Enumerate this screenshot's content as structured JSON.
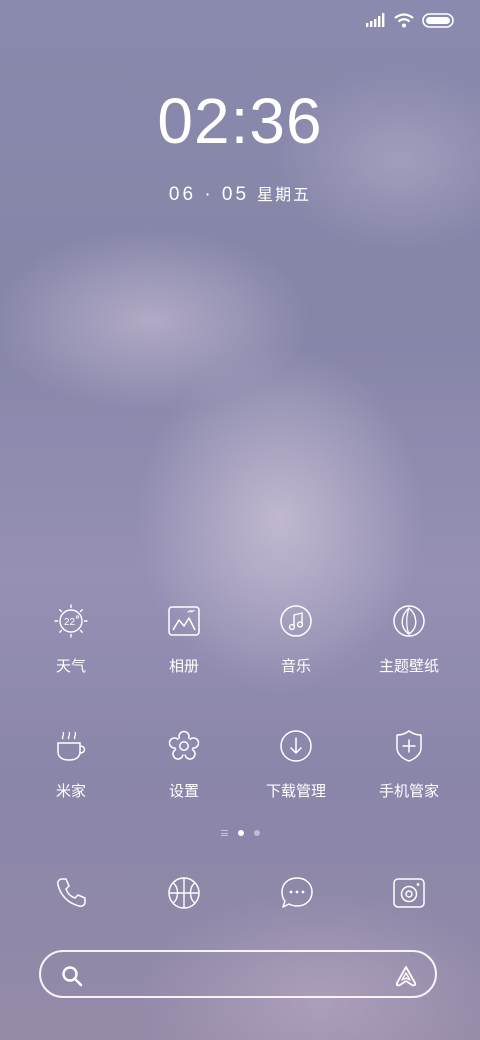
{
  "status_bar": {
    "icons": [
      "signal-icon",
      "wifi-icon",
      "battery-icon"
    ]
  },
  "lockscreen": {
    "time": "02:36",
    "date": "06 · 05",
    "weekday": "星期五"
  },
  "apps": [
    {
      "label": "天气",
      "icon": "weather-icon",
      "temperature": "22"
    },
    {
      "label": "相册",
      "icon": "gallery-icon"
    },
    {
      "label": "音乐",
      "icon": "music-icon"
    },
    {
      "label": "主题壁纸",
      "icon": "themes-icon"
    },
    {
      "label": "米家",
      "icon": "mijia-icon"
    },
    {
      "label": "设置",
      "icon": "settings-icon"
    },
    {
      "label": "下载管理",
      "icon": "download-icon"
    },
    {
      "label": "手机管家",
      "icon": "security-icon"
    }
  ],
  "page_indicator": {
    "pages": 3,
    "active": 1
  },
  "dock": [
    {
      "icon": "phone-icon"
    },
    {
      "icon": "browser-icon"
    },
    {
      "icon": "messages-icon"
    },
    {
      "icon": "camera-icon"
    }
  ],
  "search_bar": {
    "left_icon": "search-icon",
    "right_icon": "assistant-icon"
  },
  "colors": {
    "foreground": "#ffffff",
    "wallpaper_base": "#8a8aae"
  }
}
